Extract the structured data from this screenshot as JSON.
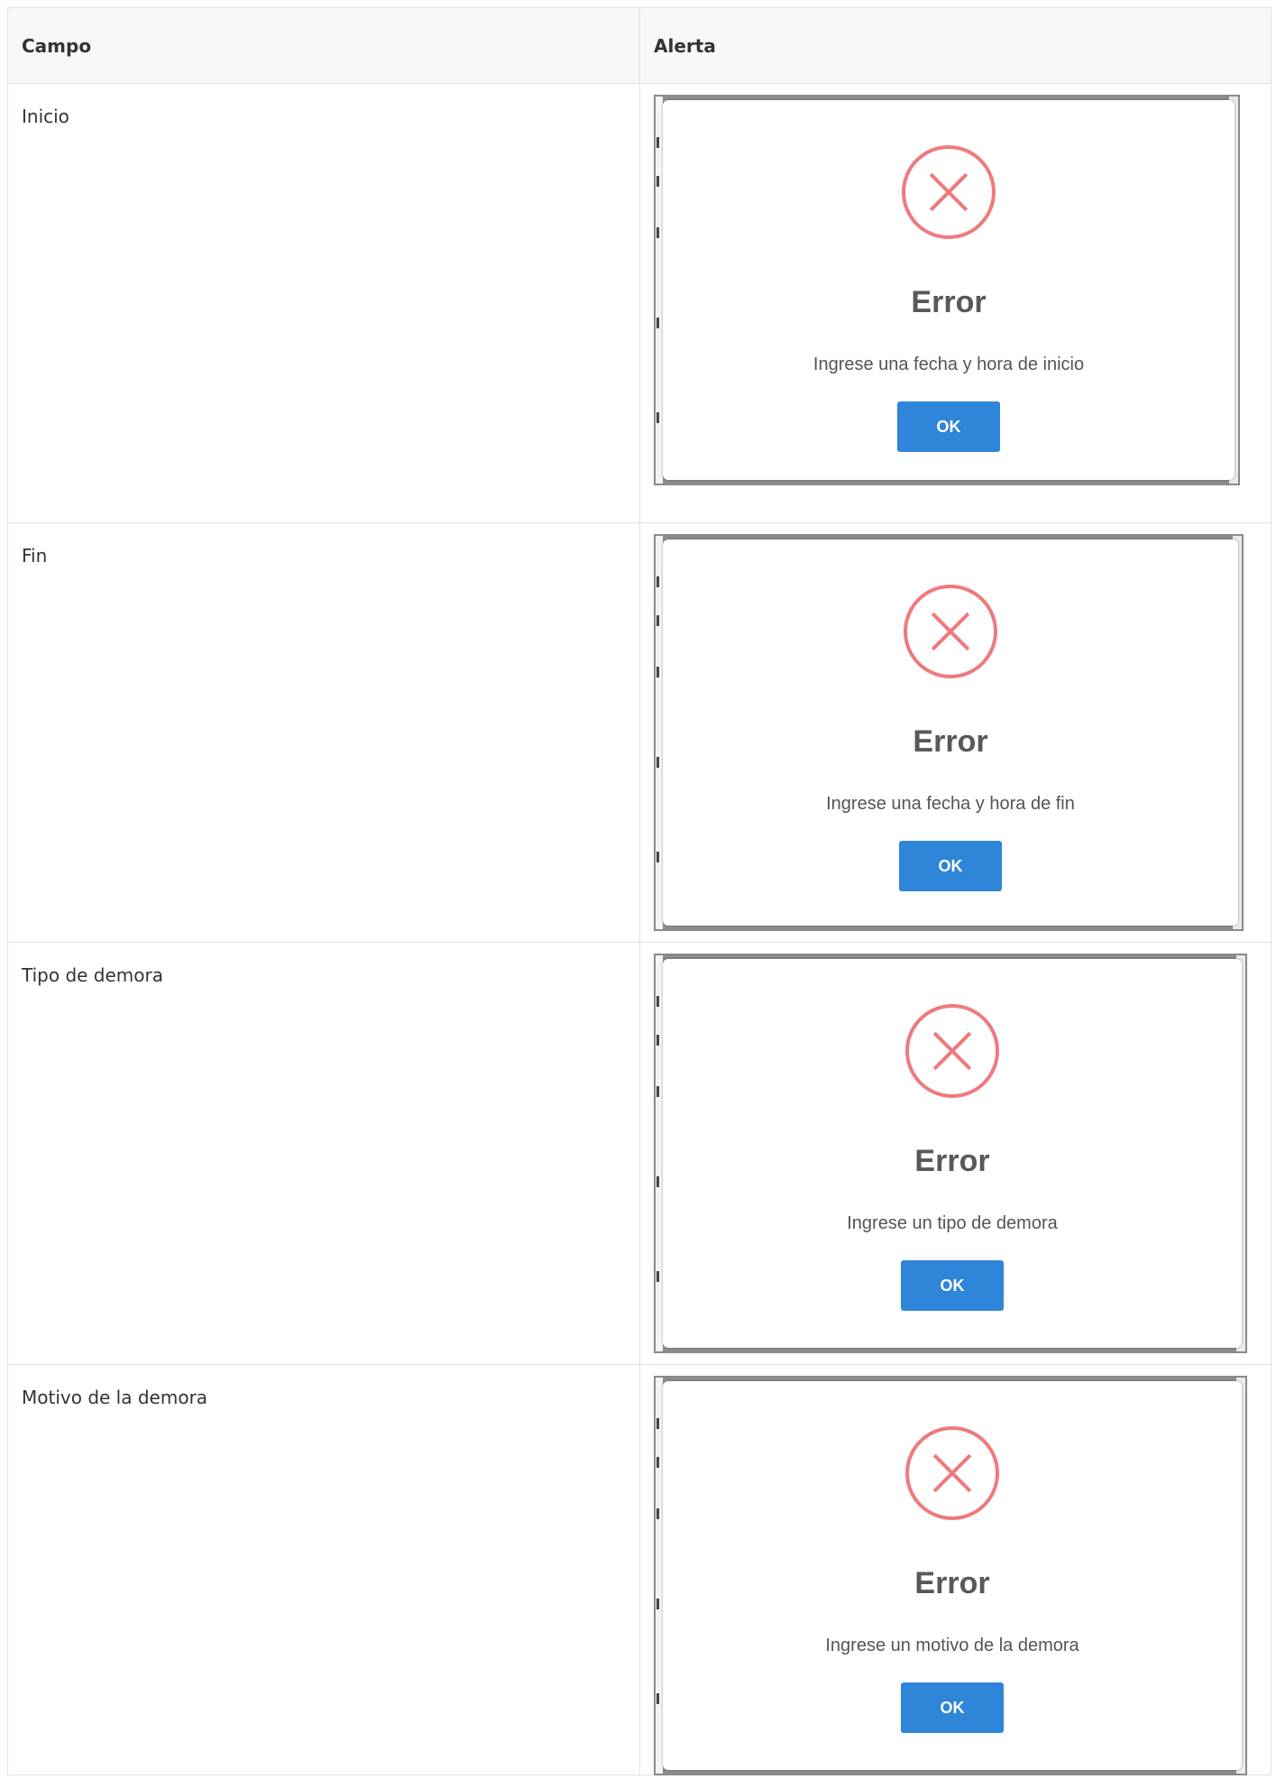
{
  "table": {
    "headers": {
      "field": "Campo",
      "alert": "Alerta"
    },
    "rows": [
      {
        "field": "Inicio",
        "dialog": {
          "title": "Error",
          "message": "Ingrese una fecha y hora de inicio",
          "button": "OK"
        }
      },
      {
        "field": "Fin",
        "dialog": {
          "title": "Error",
          "message": "Ingrese una fecha y hora de fin",
          "button": "OK"
        }
      },
      {
        "field": "Tipo de demora",
        "dialog": {
          "title": "Error",
          "message": "Ingrese un tipo de demora",
          "button": "OK"
        }
      },
      {
        "field": "Motivo de la demora",
        "dialog": {
          "title": "Error",
          "message": "Ingrese un motivo de la demora",
          "button": "OK"
        }
      }
    ]
  },
  "colors": {
    "error_icon": "#ee7a7d",
    "ok_button": "#2f85d8"
  },
  "icons": {
    "dialog_icon": "error-x-circle-icon"
  }
}
